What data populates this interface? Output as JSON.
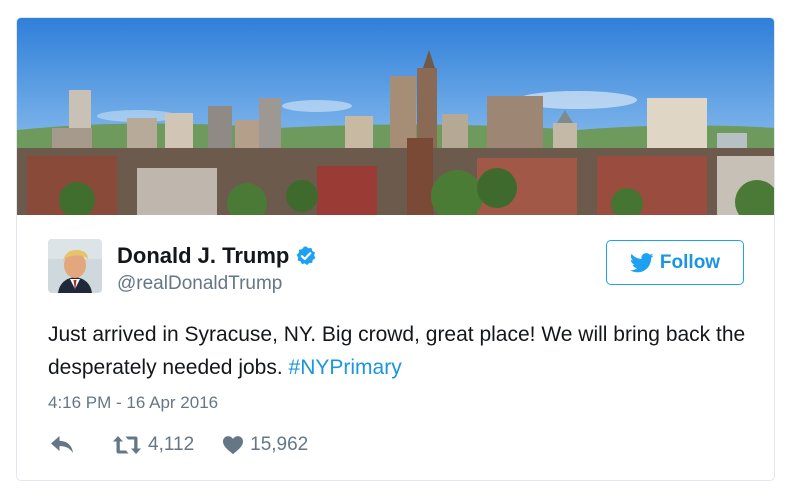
{
  "tweet": {
    "banner_image": "Syracuse city skyline",
    "author": {
      "display_name": "Donald J. Trump",
      "handle": "@realDonaldTrump",
      "verified": true,
      "avatar_icon": "avatar-portrait"
    },
    "follow_label": "Follow",
    "text_main": "Just arrived in Syracuse, NY. Big crowd, great place! We will bring back the desperately needed jobs. ",
    "hashtag": "#NYPrimary",
    "timestamp": "4:16 PM - 16 Apr 2016",
    "retweet_count": "4,112",
    "like_count": "15,962",
    "icons": {
      "reply": "reply-icon",
      "retweet": "retweet-icon",
      "like": "heart-icon",
      "verified": "verified-badge-icon",
      "follow": "twitter-bird-icon"
    }
  },
  "colors": {
    "accent": "#1b95e0",
    "text": "#14171a",
    "muted": "#657786",
    "border": "#e1e8ed"
  }
}
